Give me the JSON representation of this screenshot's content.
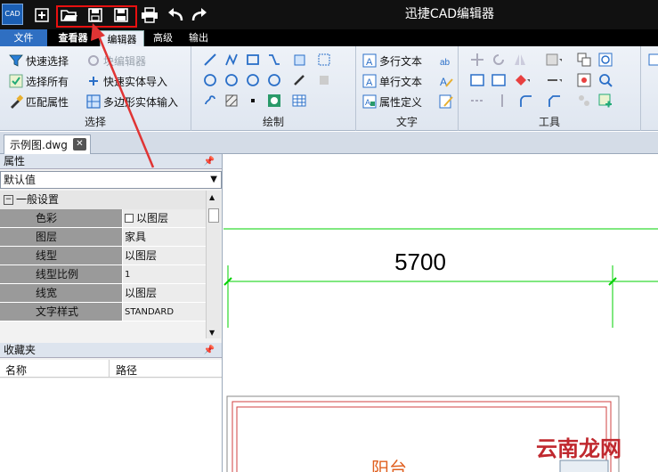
{
  "app": {
    "title": "迅捷CAD编辑器",
    "icon_label": "CAD"
  },
  "quick_access": [
    "new-icon",
    "open-folder-icon",
    "save-icon",
    "save-as-icon",
    "print-icon",
    "undo-icon",
    "redo-icon"
  ],
  "menu": {
    "file": "文件",
    "viewer": "查看器",
    "editor": "编辑器",
    "advanced": "高级",
    "output": "输出"
  },
  "ribbon": {
    "select": {
      "label": "选择",
      "quick_select": "快速选择",
      "block_editor": "块编辑器",
      "select_all": "选择所有",
      "fast_entity_import": "快速实体导入",
      "match_properties": "匹配属性",
      "polygon_entity_input": "多边形实体输入"
    },
    "draw": {
      "label": "绘制"
    },
    "text": {
      "label": "文字",
      "mtext": "多行文本",
      "stext": "单行文本",
      "attdef": "属性定义"
    },
    "tools": {
      "label": "工具"
    }
  },
  "document": {
    "tab": "示例图.dwg"
  },
  "properties": {
    "header": "属性",
    "combo_value": "默认值",
    "category": "一般设置",
    "rows": [
      {
        "name": "色彩",
        "value": "以图层"
      },
      {
        "name": "图层",
        "value": "家具"
      },
      {
        "name": "线型",
        "value": "以图层"
      },
      {
        "name": "线型比例",
        "value": "1"
      },
      {
        "name": "线宽",
        "value": "以图层"
      },
      {
        "name": "文字样式",
        "value": "STANDARD"
      }
    ]
  },
  "favorites": {
    "header": "收藏夹",
    "col_name": "名称",
    "col_path": "路径"
  },
  "drawing": {
    "dimension": "5700",
    "room_label": "阳台"
  },
  "watermark": "云南龙网",
  "colors": {
    "highlight": "#e81010",
    "dimension_green": "#00d000",
    "wall_red": "#d04040"
  }
}
